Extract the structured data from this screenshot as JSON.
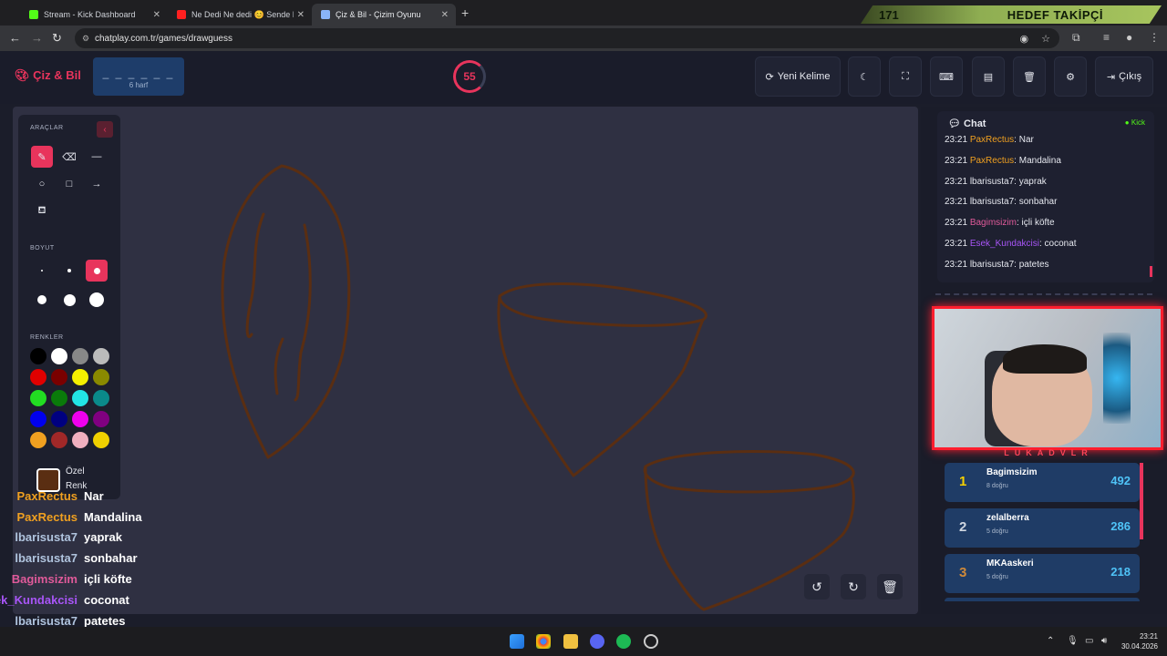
{
  "browser": {
    "tabs": [
      {
        "label": "Stream - Kick Dashboard",
        "color": "#53fc18"
      },
      {
        "label": "Ne Dedi Ne dedi 😊 Sende Bu",
        "color": "#ff2020"
      },
      {
        "label": "Çiz & Bil - Çizim Oyunu",
        "color": "#8ab4f8"
      }
    ],
    "new_tab": "+",
    "url": "chatplay.com.tr/games/drawguess"
  },
  "banner": {
    "number": "171",
    "goal": "HEDEF TAKİPÇİ"
  },
  "header": {
    "logo": "Çiz & Bil",
    "word_mask": "_ _ _ _ _ _",
    "word_length": "6 harf",
    "timer": "55",
    "new_word": "Yeni Kelime",
    "exit": "Çıkış"
  },
  "tools": {
    "section_tools": "ARAÇLAR",
    "section_size": "BOYUT",
    "section_colors": "RENKLER",
    "custom_color_line1": "Özel",
    "custom_color_line2": "Renk",
    "active_tool": "brush-icon",
    "brush_color": "#5a2e12",
    "palette": [
      "#000000",
      "#ffffff",
      "#888888",
      "#bbbbbb",
      "#e00000",
      "#7a0000",
      "#f5f000",
      "#8a8a00",
      "#22dd22",
      "#0a7a0a",
      "#22e5e5",
      "#0a8a8a",
      "#0000ee",
      "#000080",
      "#ee00ee",
      "#800080",
      "#f0a020",
      "#a02828",
      "#f0b0c0",
      "#f0d000"
    ]
  },
  "overlay_chat": [
    {
      "user": "PaxRectus",
      "msg": "Nar",
      "color": "#f0a020"
    },
    {
      "user": "PaxRectus",
      "msg": "Mandalina",
      "color": "#f0a020"
    },
    {
      "user": "lbarisusta7",
      "msg": "yaprak",
      "color": "#b0c4de"
    },
    {
      "user": "lbarisusta7",
      "msg": "sonbahar",
      "color": "#b0c4de"
    },
    {
      "user": "Bagimsizim",
      "msg": "içli köfte",
      "color": "#e05a9a"
    },
    {
      "user": "Esek_Kundakcisi",
      "msg": "coconat",
      "color": "#a855f7"
    },
    {
      "user": "lbarisusta7",
      "msg": "patetes",
      "color": "#b0c4de"
    }
  ],
  "chat": {
    "title": "Chat",
    "source": "Kick",
    "messages": [
      {
        "time": "23:21",
        "user": "PaxRectus",
        "msg": "Nar",
        "color": "#f0a020"
      },
      {
        "time": "23:21",
        "user": "PaxRectus",
        "msg": "Mandalina",
        "color": "#f0a020"
      },
      {
        "time": "23:21",
        "user": "lbarisusta7",
        "msg": "yaprak",
        "color": "#e6e8ef"
      },
      {
        "time": "23:21",
        "user": "lbarisusta7",
        "msg": "sonbahar",
        "color": "#e6e8ef"
      },
      {
        "time": "23:21",
        "user": "Bagimsizim",
        "msg": "içli köfte",
        "color": "#e05a9a"
      },
      {
        "time": "23:21",
        "user": "Esek_Kundakcisi",
        "msg": "coconat",
        "color": "#a855f7"
      },
      {
        "time": "23:21",
        "user": "lbarisusta7",
        "msg": "patetes",
        "color": "#e6e8ef"
      }
    ]
  },
  "webcam": {
    "name": "LUKADVLR"
  },
  "leaderboard": [
    {
      "rank": "1",
      "name": "Bagimsizim",
      "sub": "8 doğru",
      "score": "492",
      "rank_color": "#f5d000"
    },
    {
      "rank": "2",
      "name": "zelalberra",
      "sub": "5 doğru",
      "score": "286",
      "rank_color": "#cfd6e0"
    },
    {
      "rank": "3",
      "name": "MKAaskeri",
      "sub": "5 doğru",
      "score": "218",
      "rank_color": "#d08a3a"
    }
  ],
  "taskbar": {
    "time": "23:21",
    "date": "30.04.2026"
  }
}
